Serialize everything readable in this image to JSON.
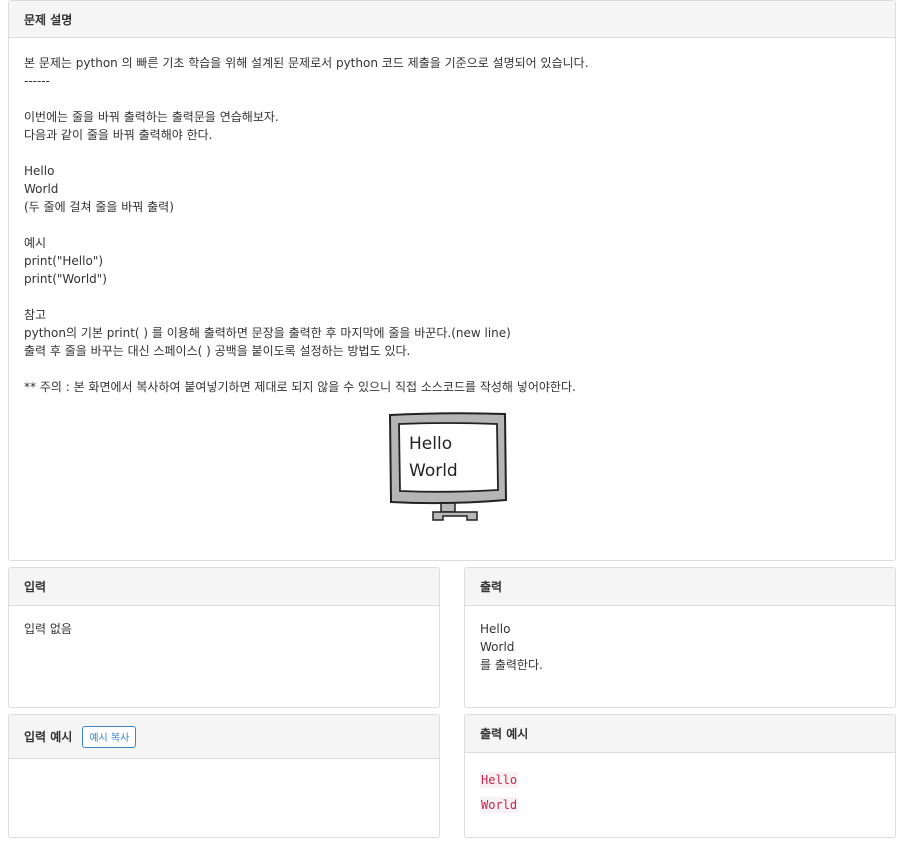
{
  "description": {
    "title": "문제 설명",
    "lines": [
      "본 문제는 python 의 빠른 기초 학습을 위해 설계된 문제로서 python 코드 제출을 기준으로 설명되어 있습니다.",
      "------",
      "",
      "이번에는 줄을 바꿔 출력하는 출력문을 연습해보자.",
      "다음과 같이 줄을 바꿔 출력해야 한다.",
      "",
      "Hello",
      "World",
      "(두 줄에 걸쳐 줄을 바꿔 출력)",
      "",
      "예시",
      "print(\"Hello\")",
      "print(\"World\")",
      "",
      "참고",
      "python의 기본 print( ) 를 이용해 출력하면 문장을 출력한 후 마지막에 줄을 바꾼다.(new line)",
      "출력 후 줄을 바꾸는 대신 스페이스( ) 공백을 붙이도록 설정하는 방법도 있다.",
      "",
      "** 주의 : 본 화면에서 복사하여 붙여넣기하면 제대로 되지 않을 수 있으니 직접 소스코드를 작성해 넣어야한다."
    ],
    "illustration_text": [
      "Hello",
      "World"
    ]
  },
  "input": {
    "title": "입력",
    "lines": [
      "입력 없음"
    ]
  },
  "output": {
    "title": "출력",
    "lines": [
      "Hello",
      "World",
      "를 출력한다."
    ]
  },
  "sample_input": {
    "title": "입력 예시",
    "copy_label": "예시 복사",
    "lines": []
  },
  "sample_output": {
    "title": "출력 예시",
    "lines": [
      "Hello",
      "World"
    ]
  },
  "colors": {
    "panel_border": "#dddddd",
    "heading_bg": "#f5f5f5",
    "copy_button": "#3a87c8",
    "code_text": "#c7254e",
    "code_bg": "#f9f2f4"
  }
}
